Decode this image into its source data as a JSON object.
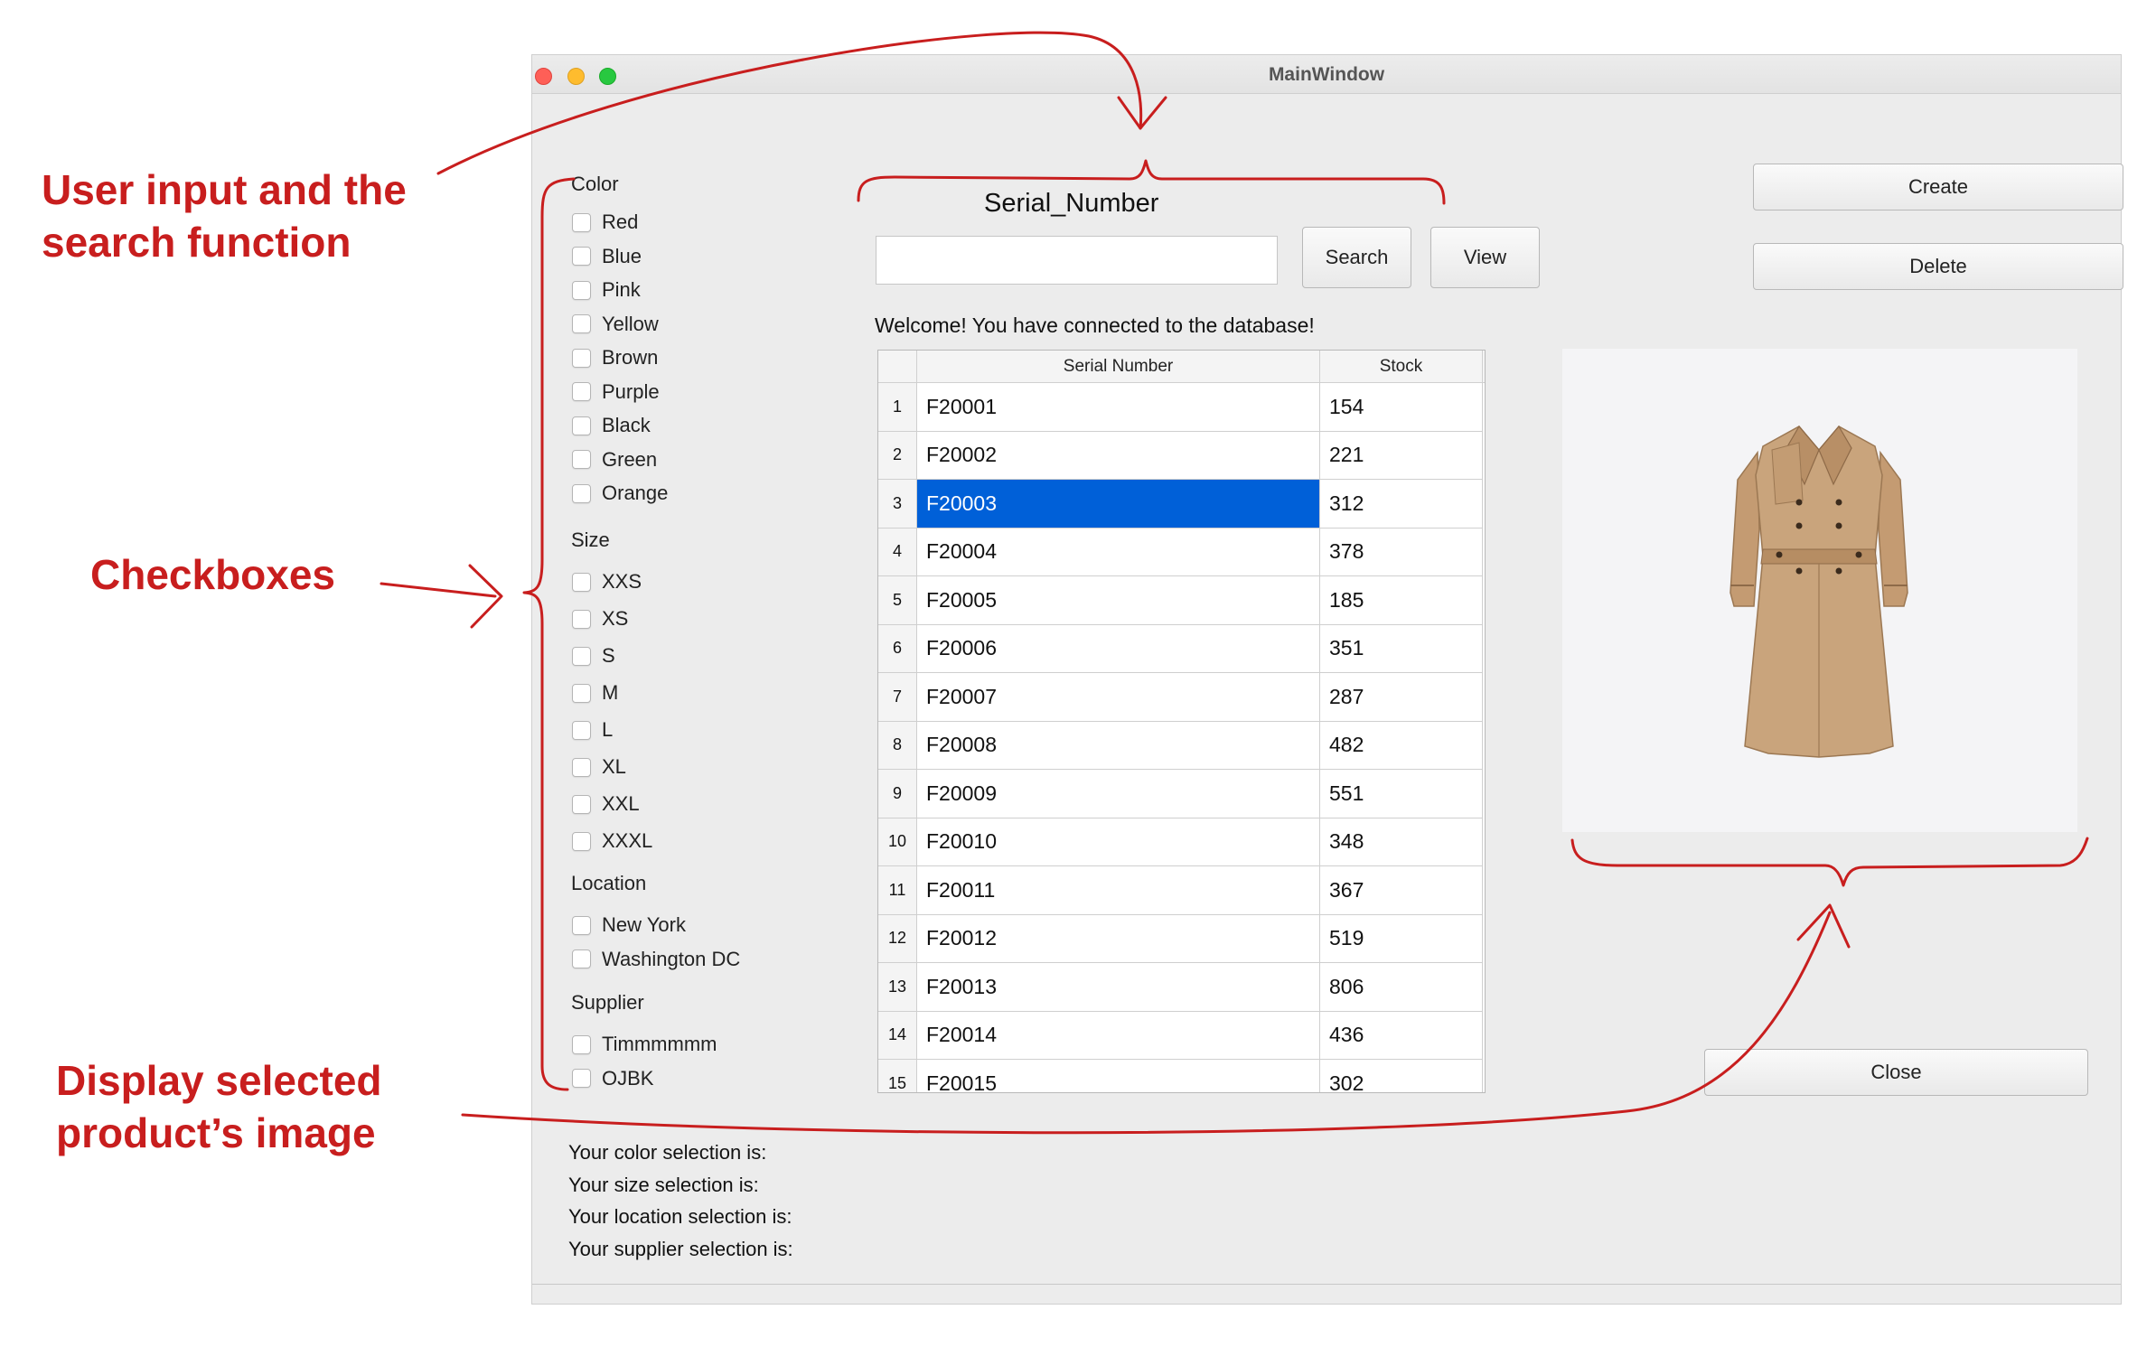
{
  "window": {
    "title": "MainWindow"
  },
  "annotations": {
    "search": [
      "User input and the",
      "search function"
    ],
    "checkboxes": "Checkboxes",
    "image": [
      "Display selected",
      "product’s image"
    ]
  },
  "filters": {
    "color": {
      "label": "Color",
      "options": [
        "Red",
        "Blue",
        "Pink",
        "Yellow",
        "Brown",
        "Purple",
        "Black",
        "Green",
        "Orange"
      ]
    },
    "size": {
      "label": "Size",
      "options": [
        "XXS",
        "XS",
        "S",
        "M",
        "L",
        "XL",
        "XXL",
        "XXXL"
      ]
    },
    "location": {
      "label": "Location",
      "options": [
        "New York",
        "Washington DC"
      ]
    },
    "supplier": {
      "label": "Supplier",
      "options": [
        "Timmmmmm",
        "OJBK"
      ]
    }
  },
  "search": {
    "heading": "Serial_Number",
    "value": "",
    "search_label": "Search",
    "view_label": "View"
  },
  "status_message": "Welcome! You have connected to the database!",
  "table": {
    "columns": [
      "Serial Number",
      "Stock"
    ],
    "selected_row": 3,
    "rows": [
      {
        "n": "1",
        "serial": "F20001",
        "stock": "154"
      },
      {
        "n": "2",
        "serial": "F20002",
        "stock": "221"
      },
      {
        "n": "3",
        "serial": "F20003",
        "stock": "312"
      },
      {
        "n": "4",
        "serial": "F20004",
        "stock": "378"
      },
      {
        "n": "5",
        "serial": "F20005",
        "stock": "185"
      },
      {
        "n": "6",
        "serial": "F20006",
        "stock": "351"
      },
      {
        "n": "7",
        "serial": "F20007",
        "stock": "287"
      },
      {
        "n": "8",
        "serial": "F20008",
        "stock": "482"
      },
      {
        "n": "9",
        "serial": "F20009",
        "stock": "551"
      },
      {
        "n": "10",
        "serial": "F20010",
        "stock": "348"
      },
      {
        "n": "11",
        "serial": "F20011",
        "stock": "367"
      },
      {
        "n": "12",
        "serial": "F20012",
        "stock": "519"
      },
      {
        "n": "13",
        "serial": "F20013",
        "stock": "806"
      },
      {
        "n": "14",
        "serial": "F20014",
        "stock": "436"
      },
      {
        "n": "15",
        "serial": "F20015",
        "stock": "302"
      }
    ]
  },
  "actions": {
    "create_label": "Create",
    "delete_label": "Delete",
    "close_label": "Close"
  },
  "selections": {
    "color": "Your color selection is:",
    "size": "Your size selection is:",
    "location": "Your location selection is:",
    "supplier": "Your supplier selection is:"
  },
  "product_image": {
    "icon": "trench-coat-image",
    "coat_color": "#c9a47c"
  },
  "colors": {
    "annotation": "#c81e1e",
    "selection": "#0060d8"
  }
}
